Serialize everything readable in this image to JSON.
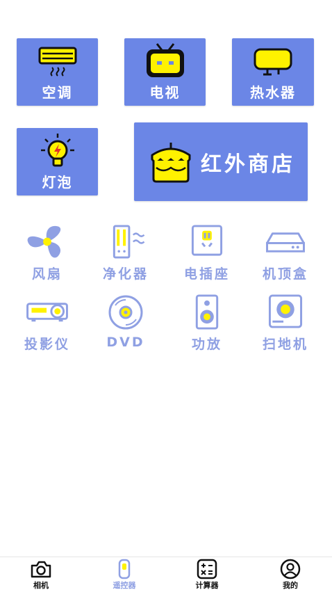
{
  "top_tiles": [
    {
      "label": "空调",
      "icon": "air-conditioner-icon"
    },
    {
      "label": "电视",
      "icon": "tv-icon"
    },
    {
      "label": "热水器",
      "icon": "water-heater-icon"
    },
    {
      "label": "灯泡",
      "icon": "light-bulb-icon"
    }
  ],
  "shop": {
    "label": "红外商店",
    "icon": "shop-icon"
  },
  "devices": [
    {
      "label": "风扇",
      "icon": "fan-icon"
    },
    {
      "label": "净化器",
      "icon": "purifier-icon"
    },
    {
      "label": "电插座",
      "icon": "socket-icon"
    },
    {
      "label": "机顶盒",
      "icon": "set-top-box-icon"
    },
    {
      "label": "投影仪",
      "icon": "projector-icon"
    },
    {
      "label": "DVD",
      "icon": "dvd-icon"
    },
    {
      "label": "功放",
      "icon": "speaker-icon"
    },
    {
      "label": "扫地机",
      "icon": "robot-vacuum-icon"
    }
  ],
  "tabbar": [
    {
      "label": "相机",
      "icon": "camera-icon"
    },
    {
      "label": "遥控器",
      "icon": "remote-icon",
      "active": true
    },
    {
      "label": "计算器",
      "icon": "calculator-icon"
    },
    {
      "label": "我的",
      "icon": "profile-icon"
    }
  ],
  "colors": {
    "tile": "#6b86e6",
    "accent_yellow": "#fff200",
    "device_text": "#8fa0e3",
    "active_tab": "#8fa0e3"
  }
}
